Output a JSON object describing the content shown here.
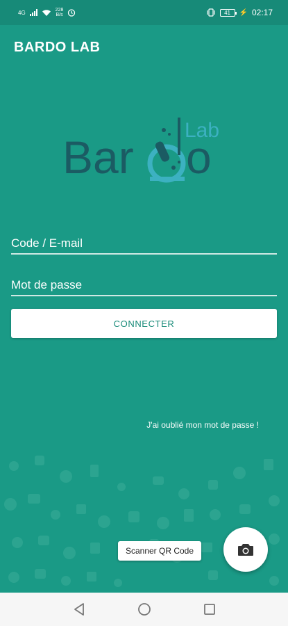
{
  "status_bar": {
    "network": "4G",
    "speed_value": "228",
    "speed_unit": "B/s",
    "battery": "41",
    "time": "02:17"
  },
  "app_bar": {
    "title": "BARDO LAB"
  },
  "logo": {
    "word_left": "Bar",
    "word_right": "o",
    "word_sup": "Lab"
  },
  "login": {
    "code_placeholder": "Code / E-mail",
    "password_placeholder": "Mot de passe",
    "connect_label": "CONNECTER",
    "forgot_label": "J'ai oublié mon mot de passe !"
  },
  "scanner": {
    "label": "Scanner QR Code",
    "fab_icon": "camera-icon"
  },
  "navigation": {
    "icons": [
      "back-icon",
      "home-icon",
      "recents-icon"
    ]
  },
  "colors": {
    "primary": "#1a9a86",
    "primary_dark": "#178a78",
    "logo_dark": "#1b5b63",
    "logo_light": "#3cb1c1"
  }
}
